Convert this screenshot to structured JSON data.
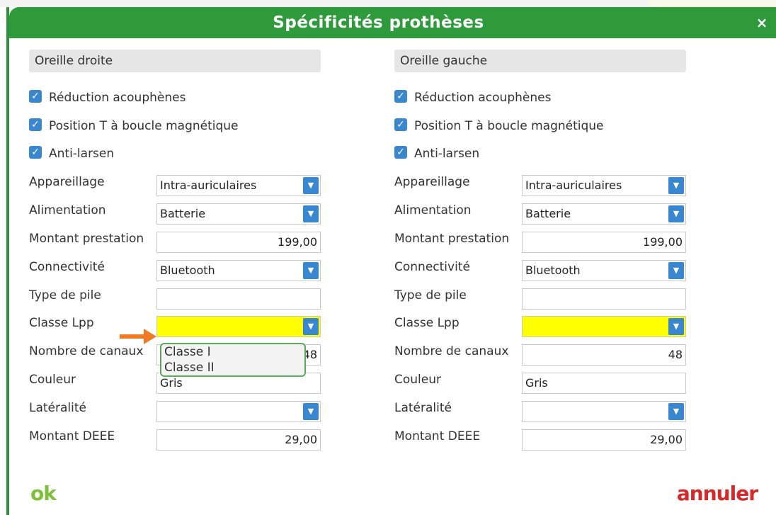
{
  "dialog": {
    "title": "Spécificités prothèses",
    "close_label": "×"
  },
  "left": {
    "header": "Oreille droite",
    "checkboxes": [
      {
        "label": "Réduction acouphènes",
        "checked": true
      },
      {
        "label": "Position T à boucle magnétique",
        "checked": true
      },
      {
        "label": "Anti-larsen",
        "checked": true
      }
    ],
    "fields": {
      "appareillage": {
        "label": "Appareillage",
        "value": "Intra-auriculaires"
      },
      "alimentation": {
        "label": "Alimentation",
        "value": "Batterie"
      },
      "montant_prestation": {
        "label": "Montant prestation",
        "value": "199,00"
      },
      "connectivite": {
        "label": "Connectivité",
        "value": "Bluetooth"
      },
      "type_pile": {
        "label": "Type de pile",
        "value": ""
      },
      "classe_lpp": {
        "label": "Classe Lpp",
        "value": ""
      },
      "nombre_canaux": {
        "label": "Nombre de canaux",
        "value": "48"
      },
      "couleur": {
        "label": "Couleur",
        "value": "Gris"
      },
      "lateralite": {
        "label": "Latéralité",
        "value": ""
      },
      "montant_deee": {
        "label": "Montant DEEE",
        "value": "29,00"
      }
    },
    "classe_options": [
      "Classe I",
      "Classe II"
    ]
  },
  "right": {
    "header": "Oreille gauche",
    "checkboxes": [
      {
        "label": "Réduction acouphènes",
        "checked": true
      },
      {
        "label": "Position T à boucle magnétique",
        "checked": true
      },
      {
        "label": "Anti-larsen",
        "checked": true
      }
    ],
    "fields": {
      "appareillage": {
        "label": "Appareillage",
        "value": "Intra-auriculaires"
      },
      "alimentation": {
        "label": "Alimentation",
        "value": "Batterie"
      },
      "montant_prestation": {
        "label": "Montant prestation",
        "value": "199,00"
      },
      "connectivite": {
        "label": "Connectivité",
        "value": "Bluetooth"
      },
      "type_pile": {
        "label": "Type de pile",
        "value": ""
      },
      "classe_lpp": {
        "label": "Classe Lpp",
        "value": ""
      },
      "nombre_canaux": {
        "label": "Nombre de canaux",
        "value": "48"
      },
      "couleur": {
        "label": "Couleur",
        "value": "Gris"
      },
      "lateralite": {
        "label": "Latéralité",
        "value": ""
      },
      "montant_deee": {
        "label": "Montant DEEE",
        "value": "29,00"
      }
    }
  },
  "footer": {
    "ok_label": "ok",
    "cancel_label": "annuler"
  },
  "colors": {
    "titlebar": "#2e9a3c",
    "checkbox": "#3a87d1",
    "highlight": "#ffff00",
    "ok": "#7fc03a",
    "cancel": "#d6272a",
    "annotation_arrow": "#f07a22"
  },
  "icons": {
    "dropdown": "chevron-down-icon",
    "check": "checkmark-icon",
    "annotation": "orange-arrow-icon"
  }
}
